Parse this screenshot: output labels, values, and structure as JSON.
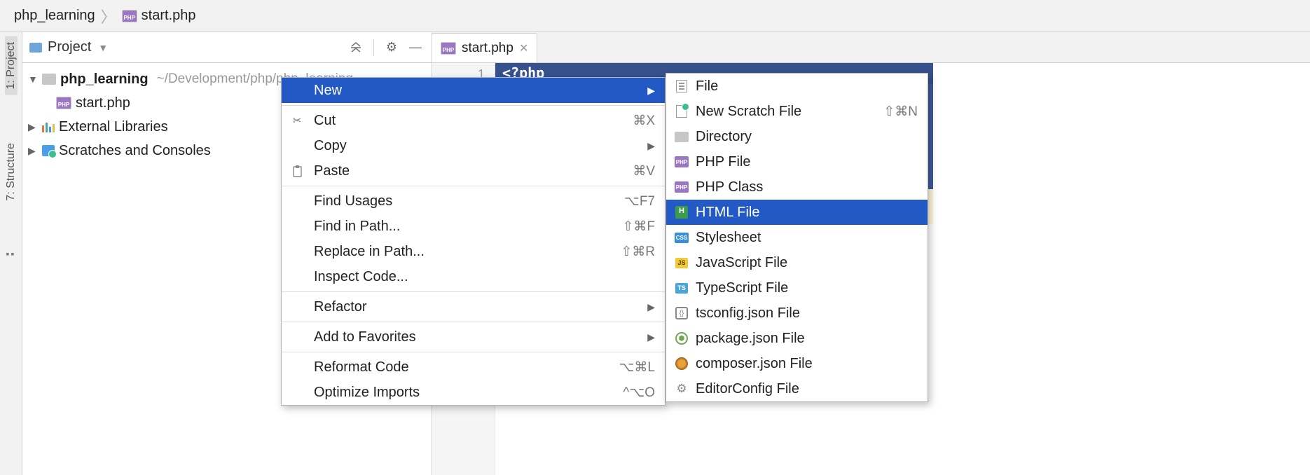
{
  "breadcrumb": {
    "root": "php_learning",
    "file": "start.php"
  },
  "rail": {
    "project": "1: Project",
    "structure": "7: Structure"
  },
  "panel": {
    "title": "Project"
  },
  "tree": {
    "root": {
      "name": "php_learning",
      "path": "~/Development/php/php_learning"
    },
    "file1": "start.php",
    "ext": "External Libraries",
    "scratch": "Scratches and Consoles"
  },
  "tab": {
    "name": "start.php"
  },
  "gutter": {
    "line1": "1"
  },
  "code": {
    "line1": "<?php"
  },
  "ctxMenu": [
    {
      "key": "new",
      "label": "New",
      "icon": "",
      "arrow": true,
      "hl": true
    },
    {
      "sep": true
    },
    {
      "key": "cut",
      "label": "Cut",
      "icon": "cut",
      "short": "⌘X"
    },
    {
      "key": "copy",
      "label": "Copy",
      "icon": "",
      "arrow": true
    },
    {
      "key": "paste",
      "label": "Paste",
      "icon": "paste",
      "short": "⌘V"
    },
    {
      "sep": true
    },
    {
      "key": "findusages",
      "label": "Find Usages",
      "icon": "",
      "short": "⌥F7"
    },
    {
      "key": "findinpath",
      "label": "Find in Path...",
      "icon": "",
      "short": "⇧⌘F"
    },
    {
      "key": "replaceinpath",
      "label": "Replace in Path...",
      "icon": "",
      "short": "⇧⌘R"
    },
    {
      "key": "inspect",
      "label": "Inspect Code...",
      "icon": ""
    },
    {
      "sep": true
    },
    {
      "key": "refactor",
      "label": "Refactor",
      "icon": "",
      "arrow": true
    },
    {
      "sep": true
    },
    {
      "key": "fav",
      "label": "Add to Favorites",
      "icon": "",
      "arrow": true
    },
    {
      "sep": true
    },
    {
      "key": "reformat",
      "label": "Reformat Code",
      "icon": "",
      "short": "⌥⌘L"
    },
    {
      "key": "optimize",
      "label": "Optimize Imports",
      "icon": "",
      "short": "^⌥O"
    }
  ],
  "newMenu": [
    {
      "key": "file",
      "label": "File",
      "iconClass": "file-icon"
    },
    {
      "key": "scratch",
      "label": "New Scratch File",
      "iconClass": "scratch-new-icon",
      "short": "⇧⌘N"
    },
    {
      "key": "dir",
      "label": "Directory",
      "iconClass": "dir-icon"
    },
    {
      "key": "phpfile",
      "label": "PHP File",
      "iconClass": "phpfile-icon"
    },
    {
      "key": "phpclass",
      "label": "PHP Class",
      "iconClass": "phpfile-icon"
    },
    {
      "key": "html",
      "label": "HTML File",
      "iconClass": "html-icon",
      "hl": true
    },
    {
      "key": "css",
      "label": "Stylesheet",
      "iconClass": "css-icon"
    },
    {
      "key": "js",
      "label": "JavaScript File",
      "iconClass": "js-icon"
    },
    {
      "key": "ts",
      "label": "TypeScript File",
      "iconClass": "ts-icon"
    },
    {
      "key": "tsconfig",
      "label": "tsconfig.json File",
      "iconClass": "json-icon"
    },
    {
      "key": "pkg",
      "label": "package.json File",
      "iconClass": "pkg-icon"
    },
    {
      "key": "composer",
      "label": "composer.json File",
      "iconClass": "composer-icon"
    },
    {
      "key": "editorconfig",
      "label": "EditorConfig File",
      "iconClass": "gear-icon-sm"
    }
  ]
}
